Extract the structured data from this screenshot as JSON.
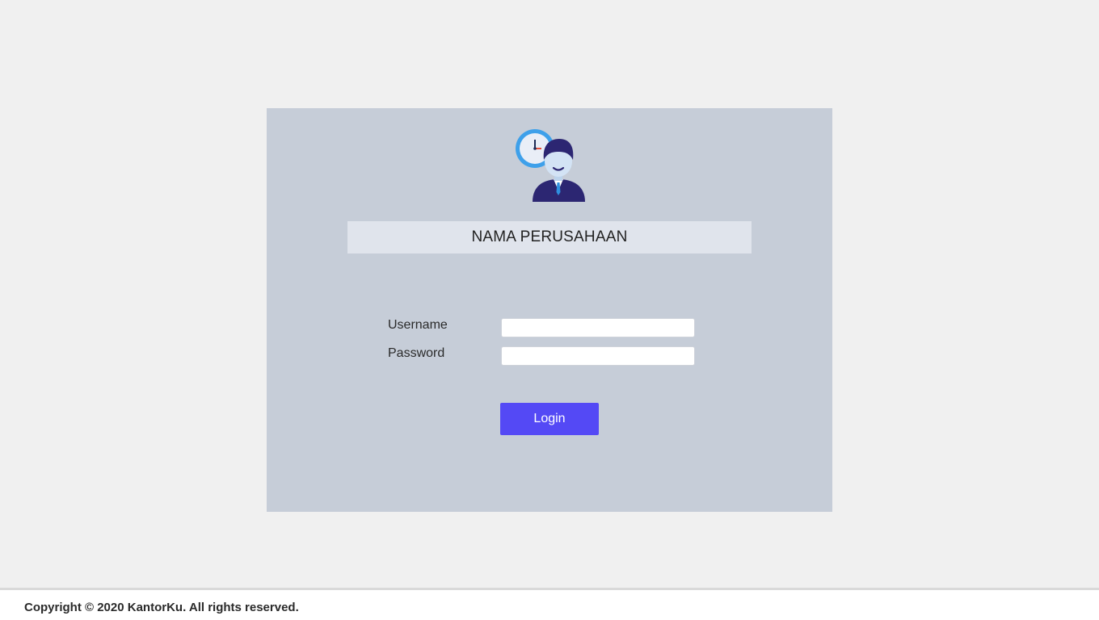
{
  "login": {
    "logo_icon": "employee-clock-icon",
    "company_name": "NAMA PERUSAHAAN",
    "username_label": "Username",
    "username_value": "",
    "password_label": "Password",
    "password_value": "",
    "login_label": "Login"
  },
  "footer": {
    "copyright": "Copyright © 2020 KantorKu. All rights reserved."
  },
  "colors": {
    "page_bg": "#f0f0f0",
    "card_bg": "#c6cdd8",
    "banner_bg": "#e0e4ec",
    "button_bg": "#5449f5"
  }
}
